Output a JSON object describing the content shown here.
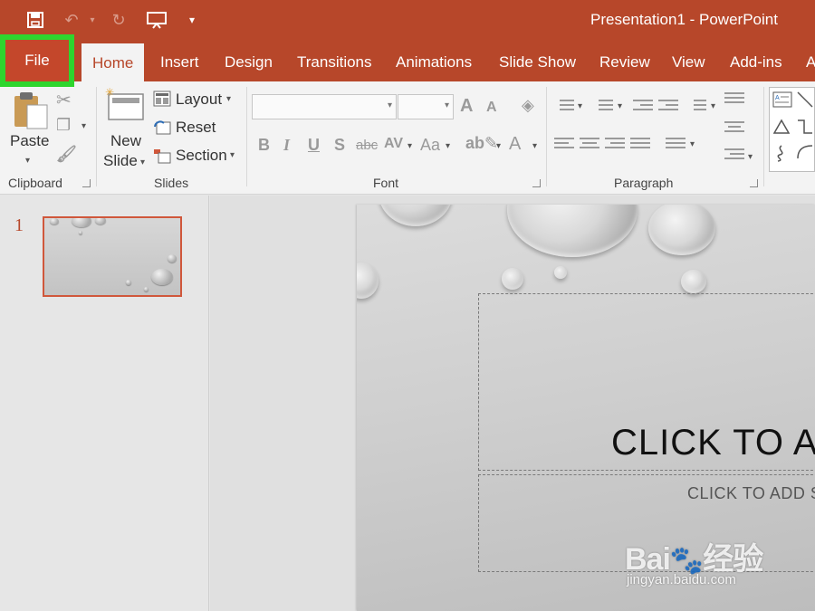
{
  "window": {
    "title": "Presentation1  -  PowerPoint"
  },
  "quick_access": [
    "save-icon",
    "undo-icon",
    "redo-icon",
    "present-from-start-icon",
    "customize-icon"
  ],
  "tabs": {
    "file": "File",
    "home": "Home",
    "insert": "Insert",
    "design": "Design",
    "transitions": "Transitions",
    "animations": "Animations",
    "slide_show": "Slide Show",
    "review": "Review",
    "view": "View",
    "add_ins": "Add-ins",
    "overflow": "A"
  },
  "ribbon": {
    "clipboard": {
      "paste": "Paste",
      "label": "Clipboard"
    },
    "slides": {
      "new_slide_line1": "New",
      "new_slide_line2": "Slide",
      "layout": "Layout",
      "reset": "Reset",
      "section": "Section",
      "label": "Slides"
    },
    "font": {
      "label": "Font",
      "bold": "B",
      "italic": "I",
      "underline": "U",
      "shadow": "S",
      "strike": "abc",
      "spacing": "AV",
      "case": "Aa",
      "grow": "A",
      "shrink": "A",
      "color": "A"
    },
    "paragraph": {
      "label": "Paragraph"
    }
  },
  "thumbnails": {
    "slide_number": "1"
  },
  "slide": {
    "title_placeholder": "CLICK TO AD",
    "subtitle_placeholder": "CLICK TO ADD S"
  },
  "watermark": {
    "logo": "Bai du 经验",
    "url": "jingyan.baidu.com"
  },
  "colors": {
    "accent": "#b7472a",
    "highlight": "#2ed52e",
    "ribbon_bg": "#f3f3f3"
  }
}
